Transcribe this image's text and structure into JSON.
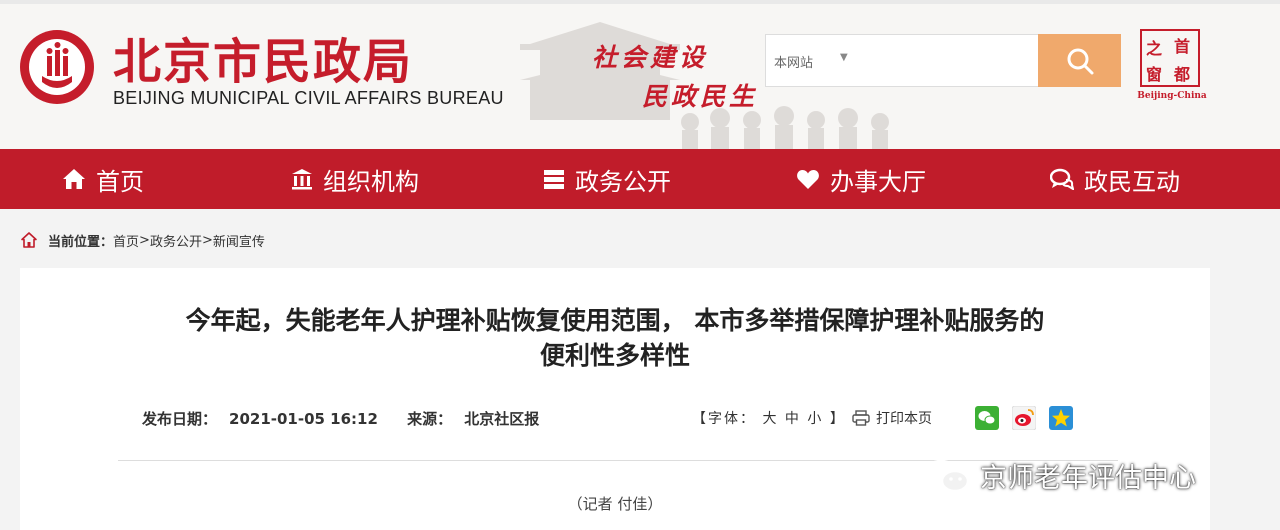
{
  "header": {
    "title": "北京市民政局",
    "subtitle": "BEIJING MUNICIPAL CIVIL AFFAIRS BUREAU",
    "slogan_line1": "社会建设",
    "slogan_line2": "民政民生",
    "search": {
      "scope": "本网站",
      "placeholder": ""
    },
    "capital_logo": {
      "chars": [
        "之",
        "首",
        "窗",
        "都"
      ],
      "caption": "Beijing-China"
    }
  },
  "nav": {
    "items": [
      {
        "label": "首页",
        "icon": "home-icon"
      },
      {
        "label": "组织机构",
        "icon": "building-icon"
      },
      {
        "label": "政务公开",
        "icon": "list-icon"
      },
      {
        "label": "办事大厅",
        "icon": "heart-icon"
      },
      {
        "label": "政民互动",
        "icon": "chat-icon"
      }
    ]
  },
  "breadcrumb": {
    "label": "当前位置：",
    "items": [
      "首页",
      "政务公开",
      "新闻宣传"
    ],
    "separator": ">"
  },
  "article": {
    "title_line1": "今年起，失能老年人护理补贴恢复使用范围， 本市多举措保障护理补贴服务的",
    "title_line2": "便利性多样性",
    "publish_label": "发布日期：",
    "publish_date": "2021-01-05 16:12",
    "source_label": "来源：",
    "source": "北京社区报",
    "font_label": "【字体：",
    "font_large": "大",
    "font_medium": "中",
    "font_small": "小",
    "font_close": "】",
    "print_label": "打印本页",
    "reporter": "（记者 付佳）"
  },
  "watermark": "京师老年评估中心",
  "colors": {
    "brand_red": "#c01c2a",
    "search_orange": "#f0a96c"
  }
}
